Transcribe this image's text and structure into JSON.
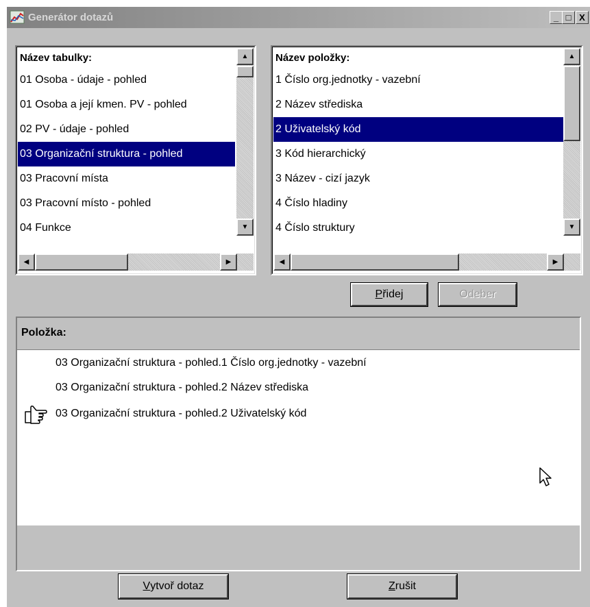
{
  "window": {
    "title": "Generátor dotazů",
    "minimize": "_",
    "maximize": "□",
    "close": "X"
  },
  "tables_list": {
    "header": "Název tabulky:",
    "items": [
      "01 Osoba - údaje - pohled",
      "01 Osoba a její kmen. PV - pohled",
      "02 PV - údaje - pohled",
      "03 Organizační struktura - pohled",
      "03 Pracovní místa",
      "03 Pracovní místo - pohled",
      "04 Funkce"
    ],
    "selected": "03 Organizační struktura - pohled"
  },
  "fields_list": {
    "header": "Název položky:",
    "items": [
      "1 Číslo org.jednotky - vazební",
      "2 Název střediska",
      "2 Uživatelský kód",
      "3 Kód hierarchický",
      "3 Název - cizí jazyk",
      "4 Číslo hladiny",
      "4 Číslo struktury"
    ],
    "selected": "2 Uživatelský kód"
  },
  "buttons": {
    "add": {
      "label": "Přidej",
      "underline": "P",
      "rest": "řidej"
    },
    "remove": {
      "label": "Odeber",
      "disabled": true
    },
    "create": {
      "label": "Vytvoř dotaz",
      "underline": "V",
      "rest": "ytvoř dotaz"
    },
    "cancel": {
      "label": "Zrušit",
      "underline": "Z",
      "rest": "rušit"
    }
  },
  "selected_items": {
    "header": "Položka:",
    "items": [
      "03 Organizační struktura - pohled.1 Číslo org.jednotky - vazební",
      "03 Organizační struktura - pohled.2 Název střediska",
      "03 Organizační struktura - pohled.2 Uživatelský kód"
    ],
    "current_index": 2
  },
  "colors": {
    "face": "#c0c0c0",
    "selection": "#000080",
    "title_gradient_start": "#818181",
    "title_gradient_end": "#bebebe"
  },
  "icons": [
    "app-icon",
    "arrow-up-icon",
    "arrow-down-icon",
    "arrow-left-icon",
    "arrow-right-icon",
    "pointing-hand-icon",
    "mouse-cursor-icon"
  ]
}
